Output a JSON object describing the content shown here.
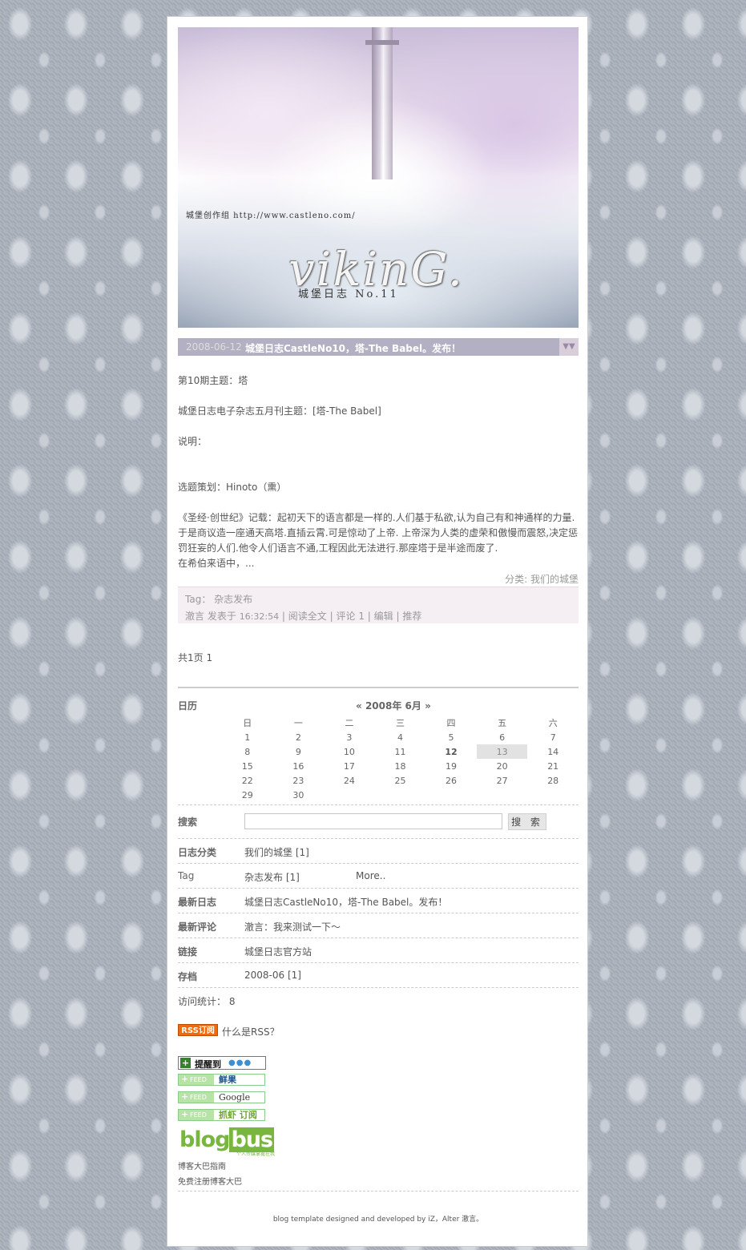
{
  "banner": {
    "caption": "城堡创作组  http://www.castleno.com/",
    "logo": "vikinG.",
    "subtitle": "城堡日志 No.11"
  },
  "post": {
    "date": "2008-06-12",
    "title": "城堡日志CastleNo10，塔-The Babel。发布！",
    "toggle_icon": "chevron-double-down-icon",
    "paragraphs": {
      "p1": "第10期主题：塔",
      "p2": "城堡日志电子杂志五月刊主题：[塔-The Babel]",
      "p3": "说明：",
      "p4": "选题策划：Hinoto（熏）",
      "p5a": "《圣经·创世纪》记载：起初天下的语言都是一样的.人们基于私欲,认为自己有和神通样的力量.",
      "p5b": "于是商议造一座通天高塔.直插云霄.可是惊动了上帝. 上帝深为人类的虚荣和傲慢而震怒,决定惩",
      "p5c": "罚狂妄的人们.他令人们语言不通,工程因此无法进行.那座塔于是半途而废了.",
      "p5d": "在希伯来语中，..."
    },
    "category_label": "分类: ",
    "category": "我们的城堡",
    "tag_label": "Tag：",
    "tag": "杂志发布",
    "author": "澈言",
    "posted_prefix": "发表于",
    "time": "16:32:54",
    "read_more": "阅读全文",
    "comments": "评论 1",
    "edit": "编辑",
    "recommend": "推荐",
    "sep": "|"
  },
  "pager": {
    "text": "共1页",
    "page": "1"
  },
  "sidebar": {
    "calendar": {
      "label": "日历",
      "prev": "«",
      "month": "2008年 6月",
      "next": "»",
      "weekdays": [
        "日",
        "一",
        "二",
        "三",
        "四",
        "五",
        "六"
      ],
      "weeks": [
        [
          "1",
          "2",
          "3",
          "4",
          "5",
          "6",
          "7"
        ],
        [
          "8",
          "9",
          "10",
          "11",
          "12",
          "13",
          "14"
        ],
        [
          "15",
          "16",
          "17",
          "18",
          "19",
          "20",
          "21"
        ],
        [
          "22",
          "23",
          "24",
          "25",
          "26",
          "27",
          "28"
        ],
        [
          "29",
          "30",
          "",
          "",
          "",
          "",
          ""
        ]
      ]
    },
    "search": {
      "label": "搜索",
      "value": "",
      "placeholder": "",
      "button": "搜 索"
    },
    "categories": {
      "label": "日志分类",
      "item": "我们的城堡 [1]"
    },
    "tags": {
      "label": "Tag",
      "item": "杂志发布 [1]",
      "more": "More.."
    },
    "latest_posts": {
      "label": "最新日志",
      "item": "城堡日志CastleNo10，塔-The Babel。发布！"
    },
    "latest_comments": {
      "label": "最新评论",
      "item": "澈言：我来测试一下～"
    },
    "links": {
      "label": "链接",
      "item": "城堡日志官方站"
    },
    "archive": {
      "label": "存档",
      "item": "2008-06 [1]"
    },
    "stats": {
      "label": "访问统计：",
      "value": "8"
    }
  },
  "feeds": {
    "rss_badge": "RSS订阅",
    "what_is_rss": "什么是RSS？",
    "remind": "提醒到",
    "feed_tag": "FEED",
    "xianguo": "鲜果",
    "google": "Google",
    "zhuaxia": "抓虾 订阅"
  },
  "footer": {
    "logo_blog": "blog",
    "logo_bus": "bus",
    "logo_small": "个人传媒掌握在我",
    "guide": "博客大巴指南",
    "register": "免费注册博客大巴",
    "credit": "blog template designed and developed by iZ，Alter 澈言。"
  },
  "colors": {
    "background": "#a9b0bb",
    "post_bar": "#b4b0c3",
    "meta_box": "#f5eef3",
    "rss": "#f06a0c",
    "blogbus_green": "#79b640"
  }
}
